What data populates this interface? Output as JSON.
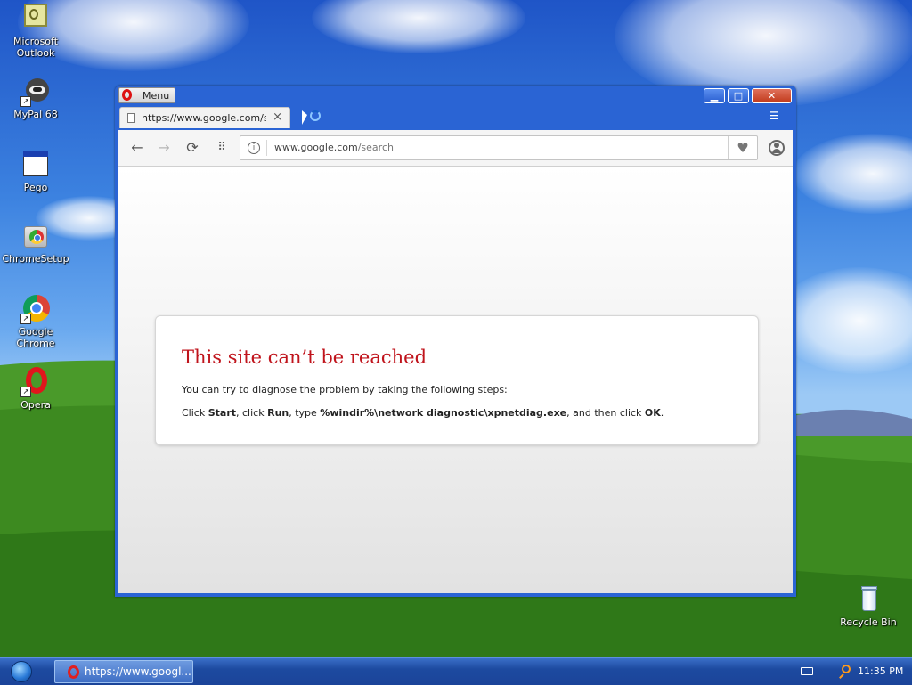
{
  "desktop": {
    "icons": [
      {
        "label": "Microsoft Outlook",
        "icon": "outlook-icon"
      },
      {
        "label": "MyPal 68",
        "icon": "mypal-icon"
      },
      {
        "label": "Pego",
        "icon": "pego-icon"
      },
      {
        "label": "ChromeSetup",
        "icon": "chrome-setup-icon"
      },
      {
        "label": "Google Chrome",
        "icon": "chrome-icon"
      },
      {
        "label": "Opera",
        "icon": "opera-icon"
      },
      {
        "label": "Recycle Bin",
        "icon": "recycle-bin-icon"
      }
    ]
  },
  "browser": {
    "menu_label": "Menu",
    "tab_title": "https://www.google.com/search",
    "url_domain": "www.google.com",
    "url_path": "/search",
    "window_controls": {
      "minimize": "▁",
      "maximize": "□",
      "close": "✕"
    }
  },
  "error": {
    "title": "This site can’t be reached",
    "line1": "You can try to diagnose the problem by taking the following steps:",
    "line2": {
      "t1": "Click ",
      "start": "Start",
      "t2": ", click ",
      "run": "Run",
      "t3": ", type ",
      "cmd": "%windir%\\network diagnostic\\xpnetdiag.exe",
      "t4": ", and then click ",
      "ok": "OK",
      "t5": "."
    }
  },
  "taskbar": {
    "task_label": "https://www.googl...",
    "clock": "11:35 PM"
  },
  "colors": {
    "error_title": "#c0141c",
    "window_frame": "#2a64d4",
    "taskbar": "#1d4aa0"
  }
}
